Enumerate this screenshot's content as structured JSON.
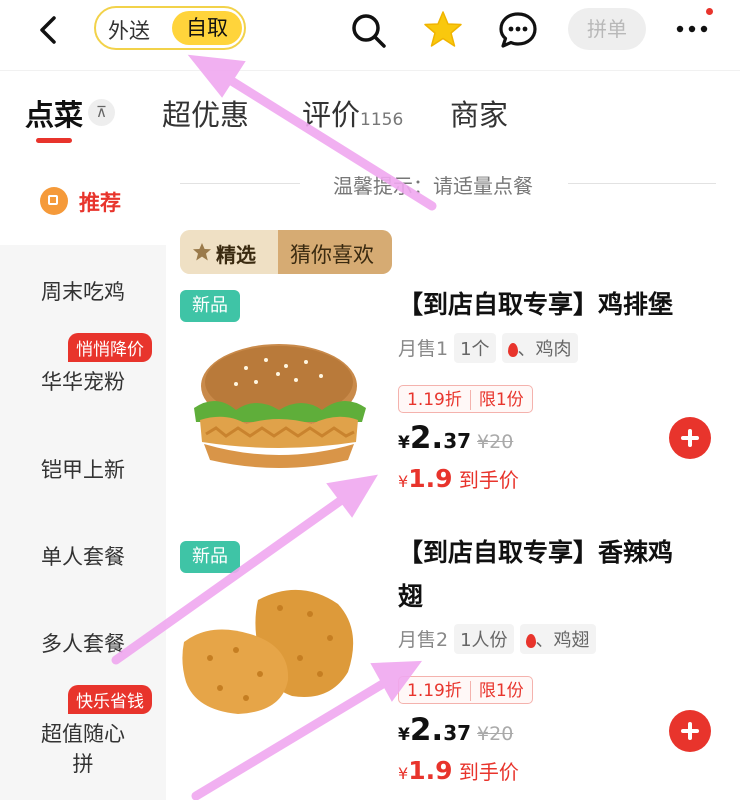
{
  "header": {
    "back_icon": "chevron-left-icon",
    "mode_toggle": {
      "delivery_label": "外送",
      "pickup_label": "自取",
      "selected": "自取"
    },
    "search_icon": "search-icon",
    "favorite_icon": "star-icon",
    "chat_icon": "chat-bubble-icon",
    "group_order_label": "拼单",
    "more_icon": "more-dots-icon"
  },
  "tabs": [
    {
      "label": "点菜",
      "active": true
    },
    {
      "label": "超优惠"
    },
    {
      "label": "评价",
      "count": "1156"
    },
    {
      "label": "商家"
    }
  ],
  "tab_collapse_glyph": "⊼",
  "tip": "温馨提示：请适量点餐",
  "sidebar": {
    "recommend_label": "推荐",
    "items": [
      {
        "label": "周末吃鸡"
      },
      {
        "label": "华华宠粉",
        "badge": "悄悄降价"
      },
      {
        "label": "铠甲上新"
      },
      {
        "label": "单人套餐"
      },
      {
        "label": "多人套餐"
      },
      {
        "label": "超值随心",
        "label2": "拼",
        "badge": "快乐省钱"
      }
    ]
  },
  "section": {
    "left_label": "精选",
    "right_label": "猜你喜欢"
  },
  "products": [
    {
      "badge": "新品",
      "title": "【到店自取专享】鸡排堡",
      "sales": "月售1",
      "spec": "1个",
      "spice_tag": "、鸡肉",
      "discount": "1.19折",
      "limit": "限1份",
      "price_symbol": "¥",
      "price_int": "2.",
      "price_dec": "37",
      "original_price": "¥20",
      "final_symbol": "¥",
      "final_int": "1.",
      "final_dec": "9",
      "final_label": " 到手价"
    },
    {
      "badge": "新品",
      "title": "【到店自取专享】香辣鸡",
      "title_line2": "翅",
      "sales": "月售2",
      "spec": "1人份",
      "spice_tag": "、鸡翅",
      "discount": "1.19折",
      "limit": "限1份",
      "price_symbol": "¥",
      "price_int": "2.",
      "price_dec": "37",
      "original_price": "¥20",
      "final_symbol": "¥",
      "final_int": "1.",
      "final_dec": "9",
      "final_label": " 到手价"
    }
  ],
  "colors": {
    "accent_red": "#e8342c",
    "toggle_yellow": "#ffd43b",
    "new_green": "#3fc4a6",
    "arrow_pink": "#f0a8f0"
  }
}
